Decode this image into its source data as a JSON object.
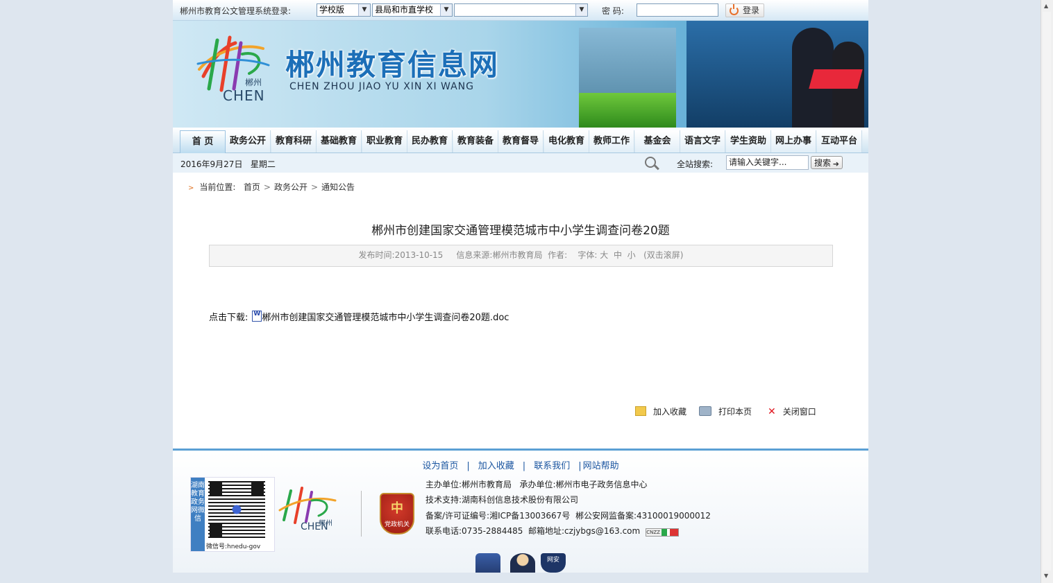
{
  "login": {
    "label": "郴州市教育公文管理系统登录:",
    "version_select": "学校版",
    "unit_select": "县局和市直学校",
    "school_select": "",
    "password_label": "密  码:",
    "login_button": "登录"
  },
  "banner": {
    "logo_cn": "郴州",
    "logo_en": "CHEN",
    "site_title": "郴州教育信息网",
    "site_pinyin": "CHEN ZHOU JIAO YU XIN XI WANG"
  },
  "nav": {
    "items": [
      "首  页",
      "政务公开",
      "教育科研",
      "基础教育",
      "职业教育",
      "民办教育",
      "教育装备",
      "教育督导",
      "电化教育",
      "教师工作",
      "基金会",
      "语言文字",
      "学生资助",
      "网上办事",
      "互动平台"
    ]
  },
  "datebar": {
    "date": "2016年9月27日",
    "weekday": "星期二",
    "search_label": "全站搜索:",
    "search_placeholder": "请输入关键字...",
    "search_button": "搜索"
  },
  "breadcrumb": {
    "label": "当前位置:",
    "items": [
      "首页",
      "政务公开",
      "通知公告"
    ]
  },
  "article": {
    "title": "郴州市创建国家交通管理模范城市中小学生调查问卷20题",
    "publish_label": "发布时间:",
    "publish_date": "2013-10-15",
    "source_label": "信息来源:",
    "source": "郴州市教育局",
    "author_label": "作者:",
    "font_label": "字体:",
    "font_large": "大",
    "font_medium": "中",
    "font_small": "小",
    "scroll_hint": "(双击滚屏)",
    "download_label": "点击下载:",
    "download_file": "郴州市创建国家交通管理模范城市中小学生调查问卷20题.doc"
  },
  "actions": {
    "favorite": "加入收藏",
    "print": "打印本页",
    "close": "关闭窗口"
  },
  "footer": {
    "links": [
      "设为首页",
      "加入收藏",
      "联系我们",
      "网站帮助"
    ],
    "qr_side_text": "湖南教育政务网微信",
    "qr_caption": "微信号:hnedu-gov",
    "logo_cn": "郴州",
    "logo_en": "CHEN",
    "badge_text": "党政机关",
    "host": "主办单位:郴州市教育局",
    "organizer": "承办单位:郴州市电子政务信息中心",
    "support": "技术支持:湖南科创信息技术股份有限公司",
    "record": "备案/许可证编号:湘ICP备13003667号",
    "police_record": "郴公安网监备案:43100019000012",
    "phone": "联系电话:0735-2884485",
    "email": "邮箱地址:czjybgs@163.com",
    "cnzz": "CNZZ",
    "police_badge": "网安"
  },
  "colors": {
    "accent": "#1c6fb8",
    "link": "#1a55a0",
    "footer_border": "#5a9fd4",
    "page_bg": "#dee6ef"
  }
}
